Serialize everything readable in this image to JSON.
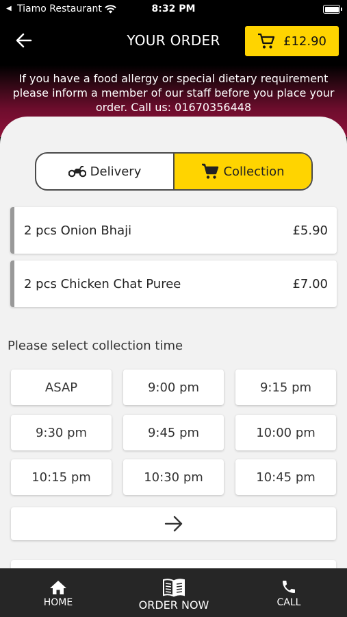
{
  "status_bar": {
    "back_glyph": "◀",
    "app_name": "Tiamo Restaurant",
    "time": "8:32 PM"
  },
  "header": {
    "title": "YOUR ORDER",
    "cart_total": "£12.90"
  },
  "allergy_notice": "If you have a food allergy or special dietary requirement please inform a member of our staff before you place your order. Call us: 01670356448",
  "order_type": {
    "delivery_label": "Delivery",
    "collection_label": "Collection",
    "selected": "Collection"
  },
  "order_items": [
    {
      "name": "2 pcs Onion Bhaji",
      "price": "£5.90"
    },
    {
      "name": "2 pcs Chicken Chat Puree",
      "price": "£7.00"
    }
  ],
  "collection_time": {
    "label": "Please select collection time",
    "slots": [
      "ASAP",
      "9:00 pm",
      "9:15 pm",
      "9:30 pm",
      "9:45 pm",
      "10:00 pm",
      "10:15 pm",
      "10:30 pm",
      "10:45 pm"
    ]
  },
  "bottom_nav": {
    "home": "HOME",
    "order_now": "ORDER NOW",
    "call": "CALL"
  },
  "colors": {
    "accent": "#ffd400",
    "header_bg": "#000000",
    "banner_gradient_end": "#8e1239",
    "nav_bg": "#262626"
  },
  "icons": [
    "wifi-icon",
    "battery-icon",
    "back-arrow-icon",
    "cart-icon",
    "motorbike-icon",
    "home-icon",
    "book-icon",
    "phone-icon",
    "arrow-right-icon"
  ]
}
